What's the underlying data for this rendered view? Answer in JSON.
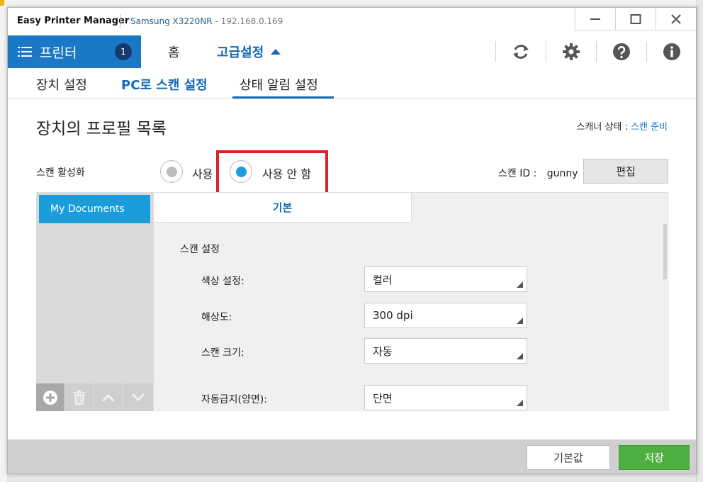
{
  "window": {
    "app_title": "Easy Printer Manager",
    "device_name": "Samsung X3220NR",
    "device_ip": "192.168.0.169"
  },
  "nav": {
    "printer_label": "프린터",
    "printer_count": "1",
    "home_label": "홈",
    "advanced_label": "고급설정"
  },
  "tabs": [
    {
      "label": "장치 설정"
    },
    {
      "label": "PC로 스캔 설정"
    },
    {
      "label": "상태 알림 설정"
    }
  ],
  "main": {
    "title": "장치의 프로필 목록",
    "scanner_status_label": "스캐너 상태 : ",
    "scanner_status_value": "스캔 준비",
    "scan_activate_label": "스캔 활성화",
    "radio_use": "사용",
    "radio_not_use": "사용 안 함",
    "selected_option": "사용 안 함",
    "scan_id_label": "스캔 ID :",
    "scan_id_value": "gunny",
    "edit_label": "편집"
  },
  "profiles": [
    {
      "name": "My Documents"
    }
  ],
  "panel": {
    "tab_label": "기본",
    "section_title": "스캔 설정",
    "fields": [
      {
        "label": "색상 설정:",
        "value": "컬러"
      },
      {
        "label": "해상도:",
        "value": "300 dpi"
      },
      {
        "label": "스캔 크기:",
        "value": "자동"
      },
      {
        "label": "자동급지(양면):",
        "value": "단면"
      }
    ]
  },
  "footer": {
    "default_label": "기본값",
    "save_label": "저장"
  },
  "colors": {
    "accent": "#1469b8",
    "printer_button": "#1a78c6",
    "radio_selected": "#1b9ddc",
    "highlight": "#e0202a",
    "save_button": "#4caf3f"
  }
}
